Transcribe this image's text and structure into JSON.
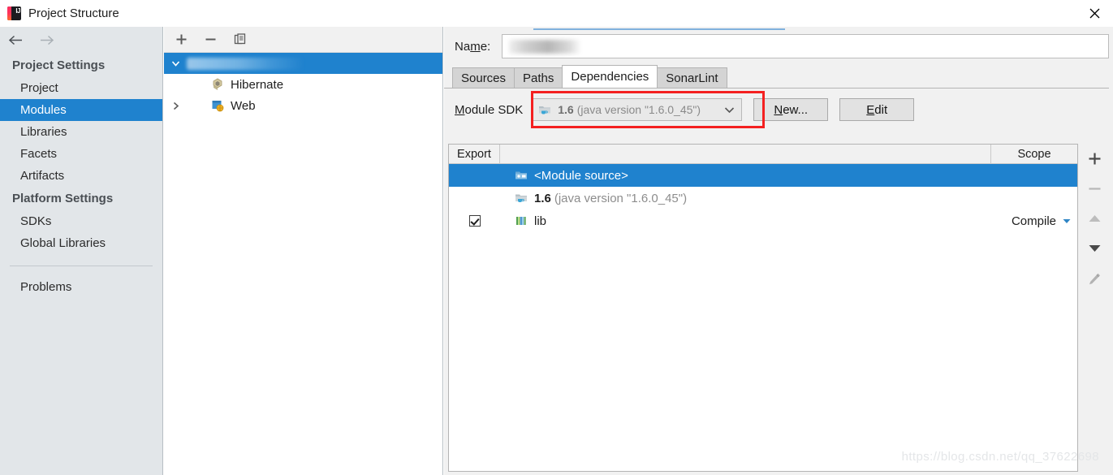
{
  "window": {
    "title": "Project Structure",
    "app_icon": "intellij-idea-icon",
    "close_icon": "close-icon"
  },
  "sidebar": {
    "back_icon": "arrow-left-icon",
    "forward_icon": "arrow-right-icon",
    "groups": [
      {
        "title": "Project Settings",
        "items": [
          {
            "label": "Project",
            "selected": false
          },
          {
            "label": "Modules",
            "selected": true
          },
          {
            "label": "Libraries",
            "selected": false
          },
          {
            "label": "Facets",
            "selected": false
          },
          {
            "label": "Artifacts",
            "selected": false
          }
        ]
      },
      {
        "title": "Platform Settings",
        "items": [
          {
            "label": "SDKs",
            "selected": false
          },
          {
            "label": "Global Libraries",
            "selected": false
          }
        ]
      }
    ],
    "problems_label": "Problems"
  },
  "tree_panel": {
    "toolbar": {
      "add_icon": "plus-icon",
      "remove_icon": "minus-icon",
      "copy_icon": "copy-icon"
    },
    "nodes": [
      {
        "label": "",
        "redacted": true,
        "selected": true,
        "expanded": true,
        "icon": "module-icon"
      },
      {
        "label": "Hibernate",
        "redacted": false,
        "selected": false,
        "icon": "hibernate-icon"
      },
      {
        "label": "Web",
        "redacted": false,
        "selected": false,
        "expanded": false,
        "icon": "web-icon"
      }
    ]
  },
  "detail": {
    "name_label": "Name:",
    "name_value": "",
    "name_redacted": true,
    "tabs": [
      {
        "label": "Sources",
        "active": false
      },
      {
        "label": "Paths",
        "active": false
      },
      {
        "label": "Dependencies",
        "active": true
      },
      {
        "label": "SonarLint",
        "active": false
      }
    ],
    "sdk": {
      "label": "Module SDK",
      "value_version": "1.6",
      "value_detail": "(java version \"1.6.0_45\")",
      "icon": "jdk-folder-icon",
      "dropdown_icon": "chevron-down-icon",
      "highlight_color": "#f42020",
      "new_button": "New...",
      "edit_button": "Edit"
    },
    "table": {
      "columns": [
        "Export",
        "Scope"
      ],
      "rows": [
        {
          "export_checked": false,
          "export_visible": false,
          "name": "<Module source>",
          "detail": "",
          "icon": "module-source-folder-icon",
          "scope": "",
          "selected": true
        },
        {
          "export_checked": false,
          "export_visible": false,
          "name": "1.6",
          "detail": "(java version \"1.6.0_45\")",
          "icon": "jdk-folder-icon",
          "scope": "",
          "selected": false
        },
        {
          "export_checked": true,
          "export_visible": true,
          "name": "lib",
          "detail": "",
          "icon": "library-icon",
          "scope": "Compile",
          "selected": false
        }
      ]
    },
    "side_toolbar": [
      {
        "icon": "plus-icon",
        "enabled": true
      },
      {
        "icon": "minus-icon",
        "enabled": false
      },
      {
        "icon": "arrow-up-icon",
        "enabled": false
      },
      {
        "icon": "arrow-down-icon",
        "enabled": true
      },
      {
        "icon": "edit-pencil-icon",
        "enabled": false
      }
    ]
  },
  "watermark": "https://blog.csdn.net/qq_37622698",
  "colors": {
    "selection_blue": "#1f82ce",
    "sidebar_bg": "#e2e6e9",
    "panel_bg": "#f1f1f1",
    "annotation_red": "#f42020"
  }
}
